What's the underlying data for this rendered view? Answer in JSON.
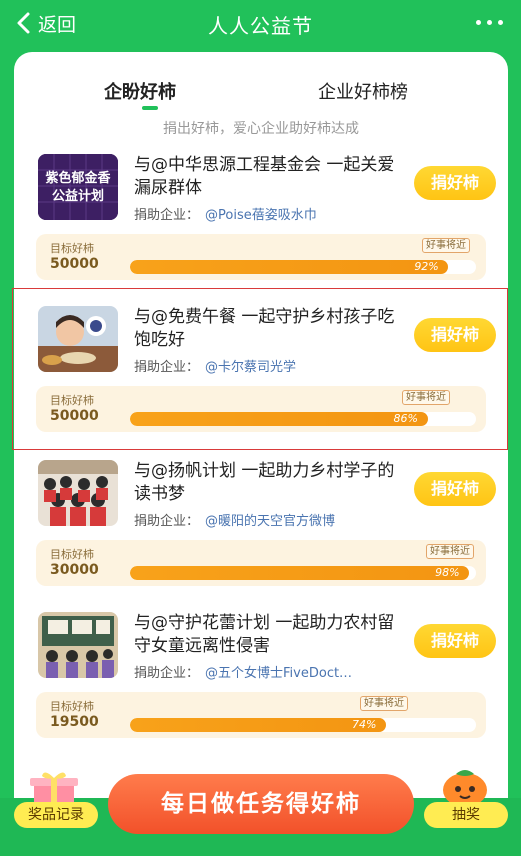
{
  "header": {
    "back_label": "返回",
    "title": "人人公益节"
  },
  "tabs": [
    {
      "label": "企盼好柿"
    },
    {
      "label": "企业好柿榜"
    }
  ],
  "subtitle": "捐出好柿，爱心企业助好柿达成",
  "sponsor_prefix": "捐助企业：",
  "goal_label": "目标好柿",
  "near_label": "好事将近",
  "donate_label": "捐好柿",
  "items": [
    {
      "title": "与@中华思源工程基金会 一起关爱漏尿群体",
      "sponsor": "@Poise蓓姿吸水巾",
      "goal": "50000",
      "progress": 92,
      "progress_label": "92%",
      "thumb_text": "紫色郁金香公益计划"
    },
    {
      "title": "与@免费午餐 一起守护乡村孩子吃饱吃好",
      "sponsor": "@卡尔蔡司光学",
      "goal": "50000",
      "progress": 86,
      "progress_label": "86%"
    },
    {
      "title": "与@扬帆计划 一起助力乡村学子的读书梦",
      "sponsor": "@暖阳的天空官方微博",
      "goal": "30000",
      "progress": 98,
      "progress_label": "98%"
    },
    {
      "title": "与@守护花蕾计划 一起助力农村留守女童远离性侵害",
      "sponsor": "@五个女博士FiveDoct…",
      "goal": "19500",
      "progress": 74,
      "progress_label": "74%"
    }
  ],
  "bottom": {
    "prize_label": "奖品记录",
    "task_label": "每日做任务得好柿",
    "lottery_label": "抽奖"
  },
  "colors": {
    "brand_green": "#21c15a",
    "accent_yellow": "#ffc414",
    "progress_orange": "#f39512",
    "task_button": "#f2512a"
  }
}
